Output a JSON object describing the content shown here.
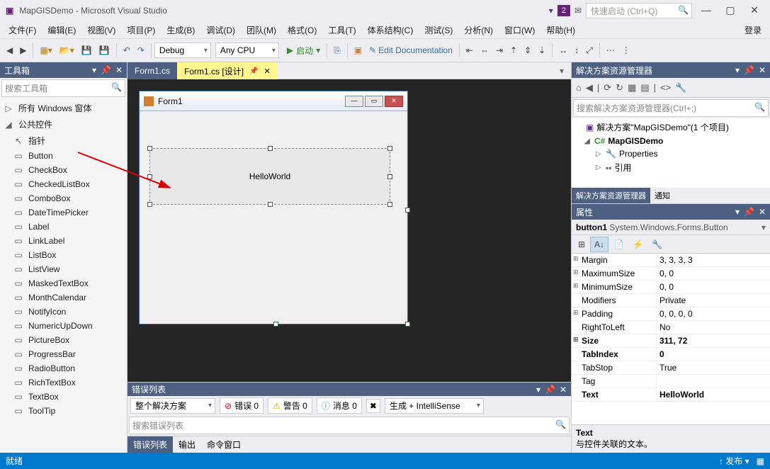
{
  "title": "MapGISDemo - Microsoft Visual Studio",
  "quicklaunch_placeholder": "快速启动 (Ctrl+Q)",
  "badge": "2",
  "login": "登录",
  "menu": [
    "文件(F)",
    "编辑(E)",
    "视图(V)",
    "项目(P)",
    "生成(B)",
    "调试(D)",
    "团队(M)",
    "格式(O)",
    "工具(T)",
    "体系结构(C)",
    "测试(S)",
    "分析(N)",
    "窗口(W)",
    "帮助(H)"
  ],
  "toolbar": {
    "config": "Debug",
    "platform": "Any CPU",
    "start": "启动",
    "editdoc": "Edit Documentation"
  },
  "toolbox": {
    "title": "工具箱",
    "search": "搜索工具箱",
    "groups": [
      "所有 Windows 窗体",
      "公共控件"
    ],
    "items": [
      "指针",
      "Button",
      "CheckBox",
      "CheckedListBox",
      "ComboBox",
      "DateTimePicker",
      "Label",
      "LinkLabel",
      "ListBox",
      "ListView",
      "MaskedTextBox",
      "MonthCalendar",
      "NotifyIcon",
      "NumericUpDown",
      "PictureBox",
      "ProgressBar",
      "RadioButton",
      "RichTextBox",
      "TextBox",
      "ToolTip"
    ]
  },
  "tabs": {
    "inactive": "Form1.cs",
    "active": "Form1.cs [设计]"
  },
  "form": {
    "title": "Form1",
    "button_text": "HelloWorld"
  },
  "errorlist": {
    "title": "错误列表",
    "scope": "整个解决方案",
    "errors": "错误 0",
    "warnings": "警告 0",
    "messages": "消息 0",
    "build": "生成 + IntelliSense",
    "search": "搜索错误列表",
    "tabs": [
      "错误列表",
      "输出",
      "命令窗口"
    ]
  },
  "solution": {
    "title": "解决方案资源管理器",
    "search": "搜索解决方案资源管理器(Ctrl+;)",
    "root": "解决方案\"MapGISDemo\"(1 个项目)",
    "project": "MapGISDemo",
    "nodes": [
      "Properties",
      "引用"
    ],
    "bottom_tabs": [
      "解决方案资源管理器",
      "通知"
    ]
  },
  "props": {
    "title": "属性",
    "object": "button1",
    "type": "System.Windows.Forms.Button",
    "rows": [
      {
        "n": "Margin",
        "v": "3, 3, 3, 3",
        "e": true
      },
      {
        "n": "MaximumSize",
        "v": "0, 0",
        "e": true
      },
      {
        "n": "MinimumSize",
        "v": "0, 0",
        "e": true
      },
      {
        "n": "Modifiers",
        "v": "Private"
      },
      {
        "n": "Padding",
        "v": "0, 0, 0, 0",
        "e": true
      },
      {
        "n": "RightToLeft",
        "v": "No"
      },
      {
        "n": "Size",
        "v": "311, 72",
        "e": true,
        "b": true
      },
      {
        "n": "TabIndex",
        "v": "0",
        "b": true
      },
      {
        "n": "TabStop",
        "v": "True"
      },
      {
        "n": "Tag",
        "v": ""
      },
      {
        "n": "Text",
        "v": "HelloWorld",
        "b": true
      }
    ],
    "desc_name": "Text",
    "desc_text": "与控件关联的文本。"
  },
  "status": {
    "ready": "就绪",
    "publish": "发布"
  }
}
